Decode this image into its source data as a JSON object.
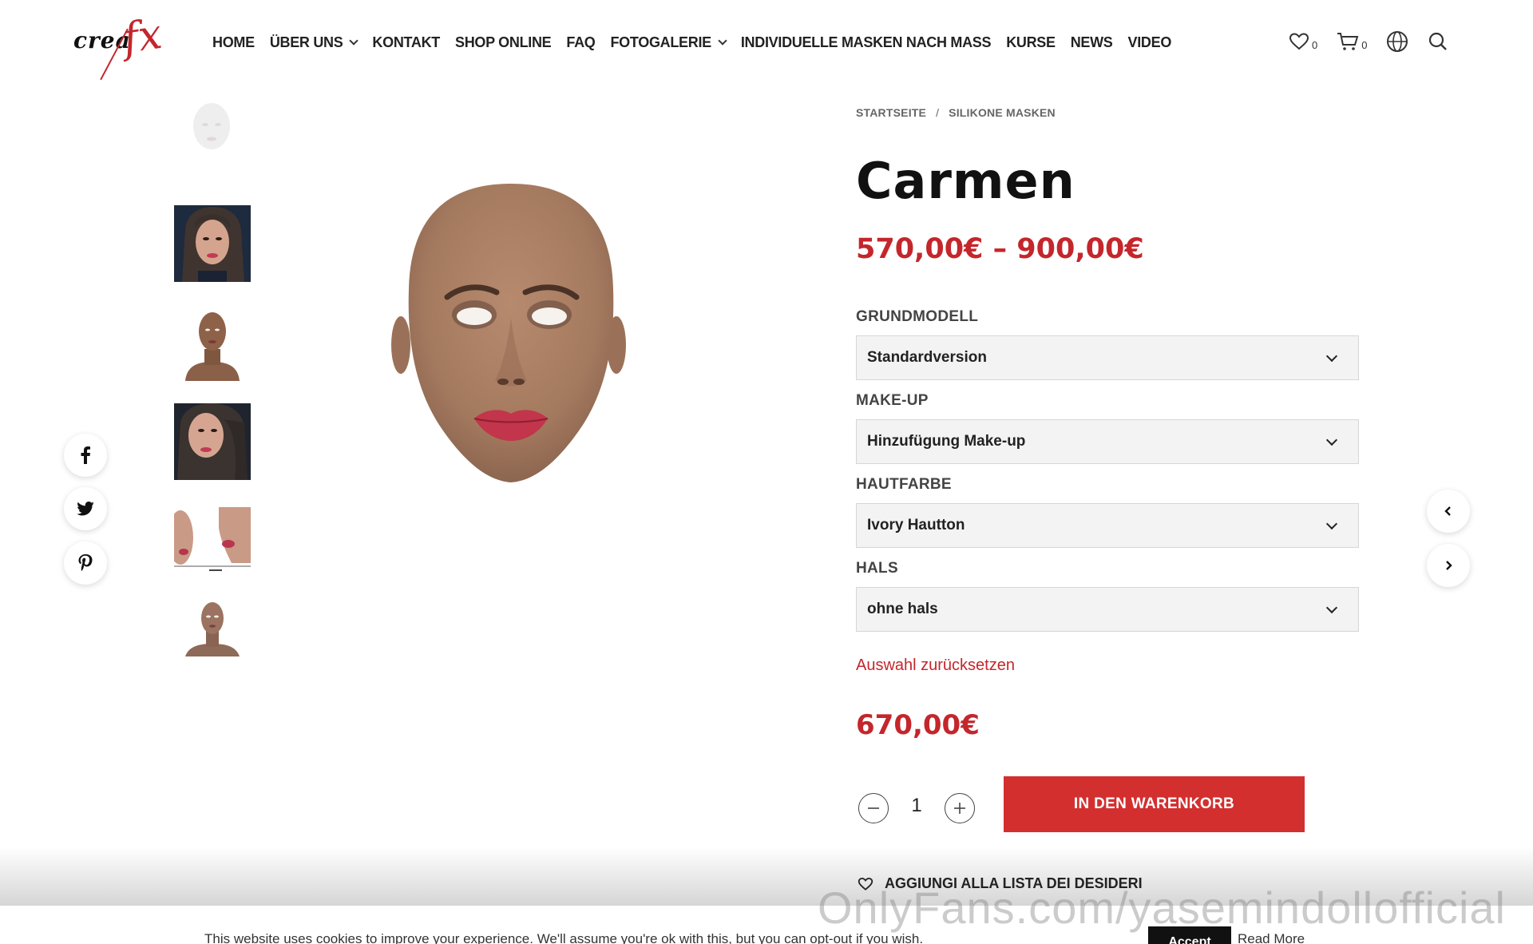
{
  "header": {
    "logo_text": "crea",
    "logo_fx": "fx",
    "nav": [
      {
        "label": "HOME",
        "has_dropdown": false
      },
      {
        "label": "ÜBER UNS",
        "has_dropdown": true
      },
      {
        "label": "KONTAKT",
        "has_dropdown": false
      },
      {
        "label": "SHOP ONLINE",
        "has_dropdown": false
      },
      {
        "label": "FAQ",
        "has_dropdown": false
      },
      {
        "label": "FOTOGALERIE",
        "has_dropdown": true
      },
      {
        "label": "INDIVIDUELLE MASKEN NACH MASS",
        "has_dropdown": false
      },
      {
        "label": "KURSE",
        "has_dropdown": false
      },
      {
        "label": "NEWS",
        "has_dropdown": false
      },
      {
        "label": "VIDEO",
        "has_dropdown": false
      }
    ],
    "wishlist_count": "0",
    "cart_count": "0",
    "icons": [
      "heart-icon",
      "cart-icon",
      "globe-icon",
      "search-icon"
    ]
  },
  "social": [
    "facebook-icon",
    "twitter-icon",
    "pinterest-icon"
  ],
  "gallery": {
    "thumbnails": [
      "mask-white",
      "woman-wig-front",
      "mask-bust",
      "woman-wig-side",
      "mask-detail-sheet",
      "mask-small-bust"
    ],
    "main_image": "silicone-mask-carmen"
  },
  "breadcrumb": {
    "home": "STARTSEITE",
    "separator": "/",
    "category": "SILIKONE MASKEN"
  },
  "product": {
    "title": "Carmen",
    "price_range": "570,00€ – 900,00€",
    "variations": [
      {
        "label": "GRUNDMODELL",
        "value": "Standardversion"
      },
      {
        "label": "MAKE-UP",
        "value": "Hinzufügung Make-up"
      },
      {
        "label": "HAUTFARBE",
        "value": "Ivory Hautton"
      },
      {
        "label": "HALS",
        "value": "ohne hals"
      }
    ],
    "reset_label": "Auswahl zurücksetzen",
    "variation_price": "670,00€",
    "quantity": "1",
    "add_to_cart": "IN DEN WARENKORB",
    "wishlist_label": "AGGIUNGI ALLA LISTA DEI DESIDERI"
  },
  "cookie": {
    "text": "This website uses cookies to improve your experience. We'll assume you're ok with this, but you can opt-out if you wish.",
    "accept": "Accept",
    "read_more": "Read More"
  },
  "watermark": "OnlyFans.com/yasemindollofficial",
  "colors": {
    "accent": "#d32f2f",
    "price": "#c4262c",
    "select_bg": "#f3f3f3"
  }
}
